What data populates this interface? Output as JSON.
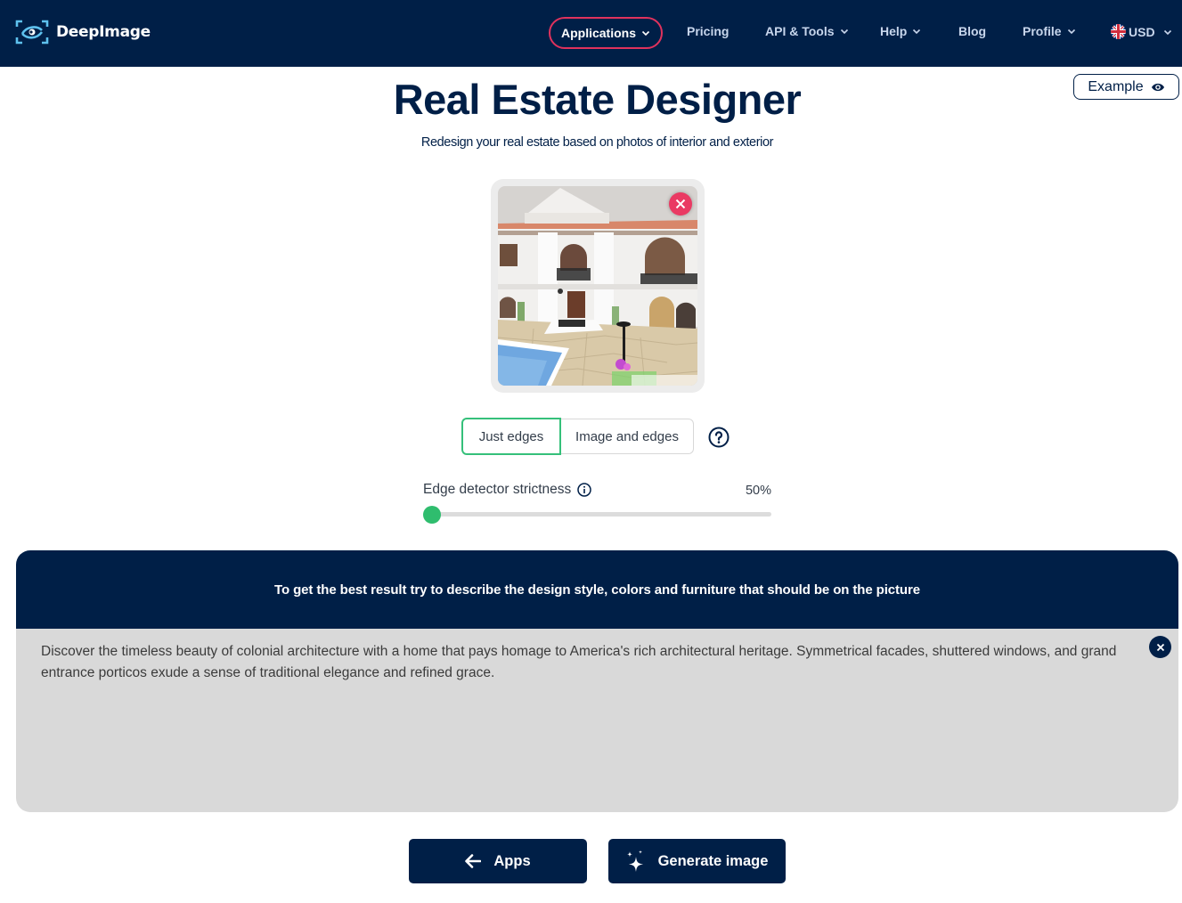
{
  "navbar": {
    "brand": "DeepImage",
    "items": [
      {
        "label": "Applications",
        "has_dropdown": true,
        "active": true
      },
      {
        "label": "Pricing",
        "has_dropdown": false
      },
      {
        "label": "API & Tools",
        "has_dropdown": true
      },
      {
        "label": "Help",
        "has_dropdown": true
      },
      {
        "label": "Blog",
        "has_dropdown": false
      },
      {
        "label": "Profile",
        "has_dropdown": true
      }
    ],
    "currency": {
      "label": "USD",
      "flag": "uk-flag-icon"
    },
    "accent_color": "#e0325d",
    "background_color": "#001f47"
  },
  "example_button": {
    "label": "Example",
    "icon": "eye-icon"
  },
  "header": {
    "title": "Real Estate Designer",
    "subtitle": "Redesign your real estate based on photos of interior and exterior"
  },
  "upload": {
    "image_alt": "Uploaded photo of white colonial-style villa with pool",
    "remove_icon": "close-icon",
    "remove_color": "#ea3a63"
  },
  "mode_toggle": {
    "options": [
      {
        "label": "Just edges",
        "selected": true
      },
      {
        "label": "Image and edges",
        "selected": false
      }
    ],
    "help_icon": "question-circle-icon",
    "selected_color": "#35c07a"
  },
  "slider": {
    "label": "Edge detector strictness",
    "info_icon": "info-circle-icon",
    "value_text": "50%",
    "position_fraction": 0.0,
    "thumb_color": "#2fbd6e"
  },
  "prompt": {
    "hint": "To get the best result try to describe the design style, colors and furniture that should be on the picture",
    "text": "Discover the timeless beauty of colonial architecture with a home that pays homage to America's rich architectural heritage. Symmetrical facades, shuttered windows, and grand entrance porticos exude a sense of traditional elegance and refined grace.",
    "clear_icon": "close-icon"
  },
  "actions": {
    "apps_label": "Apps",
    "generate_label": "Generate image"
  }
}
